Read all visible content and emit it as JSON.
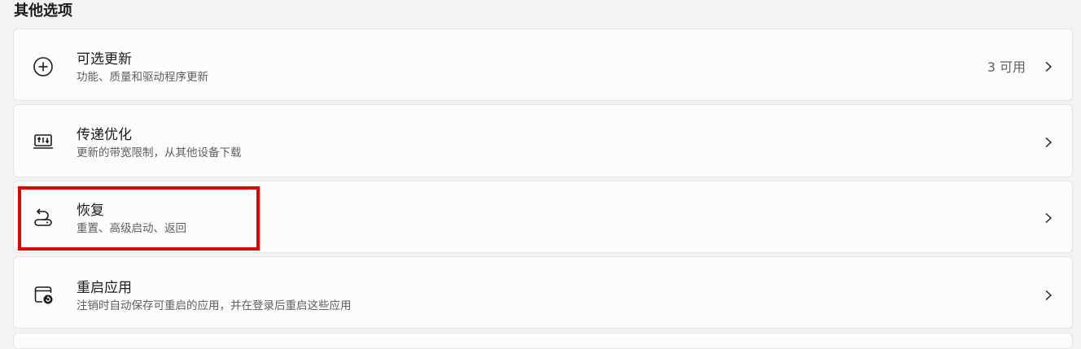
{
  "section": {
    "title": "其他选项"
  },
  "items": [
    {
      "icon": "plus-circle-icon",
      "title": "可选更新",
      "subtitle": "功能、质量和驱动程序更新",
      "meta": "3 可用"
    },
    {
      "icon": "delivery-optimization-icon",
      "title": "传递优化",
      "subtitle": "更新的带宽限制，从其他设备下载",
      "meta": ""
    },
    {
      "icon": "recovery-icon",
      "title": "恢复",
      "subtitle": "重置、高级启动、返回",
      "meta": ""
    },
    {
      "icon": "restart-apps-icon",
      "title": "重启应用",
      "subtitle": "注销时自动保存可重启的应用，并在登录后重启这些应用",
      "meta": ""
    }
  ],
  "highlight": {
    "color": "#e00000",
    "target": "恢复"
  }
}
